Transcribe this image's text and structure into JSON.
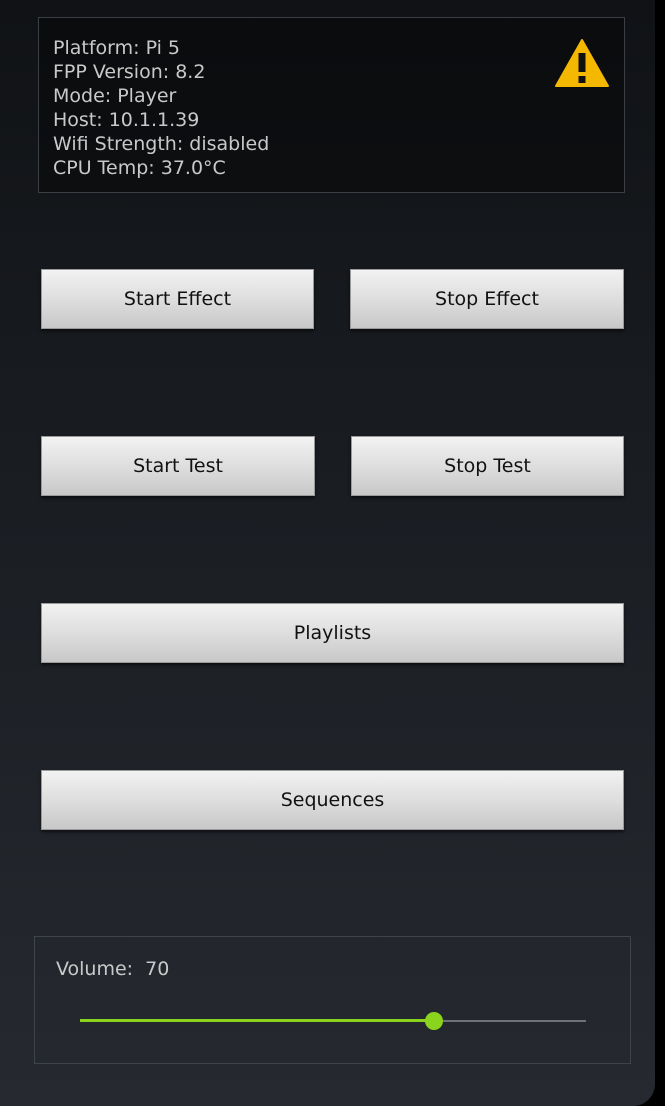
{
  "status": {
    "lines": [
      "Platform: Pi 5",
      "FPP Version: 8.2",
      "Mode: Player",
      "Host: 10.1.1.39",
      "Wifi Strength: disabled",
      "CPU Temp: 37.0°C"
    ],
    "warning_icon": "warning-triangle-icon",
    "warning_color": "#F5B800"
  },
  "buttons": {
    "start_effect": "Start Effect",
    "stop_effect": "Stop Effect",
    "start_test": "Start Test",
    "stop_test": "Stop Test",
    "playlists": "Playlists",
    "sequences": "Sequences"
  },
  "volume": {
    "label": "Volume:",
    "value": "70",
    "level_fraction": 0.7,
    "accent_color": "#8AD41E"
  }
}
